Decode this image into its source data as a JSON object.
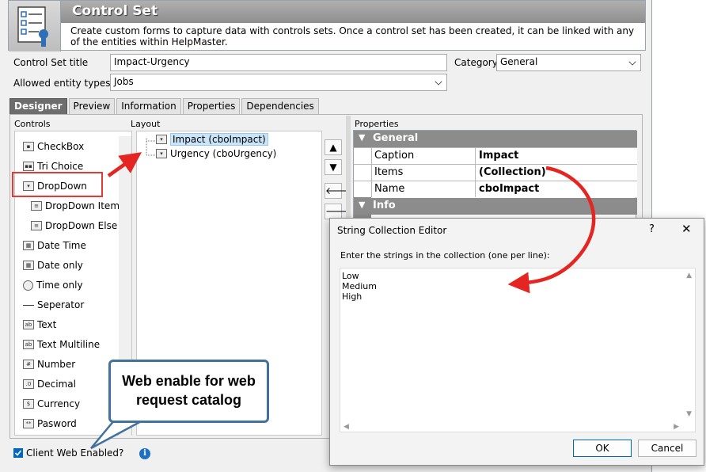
{
  "header": {
    "title": "Control Set",
    "description": "Create custom forms to capture data with controls sets.  Once a control set has been created, it can be linked with any of the entities within HelpMaster."
  },
  "form": {
    "title_label": "Control Set title",
    "title_value": "Impact-Urgency",
    "category_label": "Category",
    "category_value": "General",
    "entity_label": "Allowed entity types",
    "entity_value": "Jobs"
  },
  "tabs": [
    "Designer",
    "Preview",
    "Information",
    "Properties",
    "Dependencies"
  ],
  "sections": {
    "controls": "Controls",
    "layout": "Layout",
    "properties": "Properties"
  },
  "controls": [
    {
      "label": "CheckBox",
      "icon": "checkbox-icon"
    },
    {
      "label": "Tri Choice",
      "icon": "tri-choice-icon"
    },
    {
      "label": "DropDown",
      "icon": "dropdown-icon"
    },
    {
      "label": "DropDown Item",
      "icon": "dropdown-item-icon"
    },
    {
      "label": "DropDown Else",
      "icon": "dropdown-else-icon"
    },
    {
      "label": "Date Time",
      "icon": "date-time-icon"
    },
    {
      "label": "Date only",
      "icon": "date-only-icon"
    },
    {
      "label": "Time only",
      "icon": "clock-icon"
    },
    {
      "label": "Seperator",
      "icon": "separator-icon"
    },
    {
      "label": "Text",
      "icon": "text-icon"
    },
    {
      "label": "Text Multiline",
      "icon": "text-multiline-icon"
    },
    {
      "label": "Number",
      "icon": "number-icon"
    },
    {
      "label": "Decimal",
      "icon": "decimal-icon"
    },
    {
      "label": "Currency",
      "icon": "currency-icon"
    },
    {
      "label": "Pasword",
      "icon": "password-icon"
    }
  ],
  "layout_items": [
    "Impact (cboImpact)",
    "Urgency (cboUrgency)"
  ],
  "property_grid": {
    "general": "General",
    "info": "Info",
    "rows": [
      {
        "name": "Caption",
        "value": "Impact"
      },
      {
        "name": "Items",
        "value": "(Collection)"
      },
      {
        "name": "Name",
        "value": "cboImpact"
      }
    ]
  },
  "dialog": {
    "title": "String Collection Editor",
    "help": "?",
    "close": "✕",
    "prompt": "Enter the strings in the collection (one per line):",
    "lines": [
      "Low",
      "Medium",
      "High"
    ],
    "ok": "OK",
    "cancel": "Cancel"
  },
  "callout": "Web enable for web request catalog",
  "footer": {
    "web_enabled_label": "Client Web Enabled?",
    "info": "i"
  },
  "arrows": {
    "up": "▲",
    "down": "▼",
    "left": "🡐",
    "right": "🡒"
  },
  "colors": {
    "highlight_box": "#e53935",
    "annotation_arrow": "#e52521",
    "callout_border": "#41719c",
    "accent": "#0067c0"
  }
}
